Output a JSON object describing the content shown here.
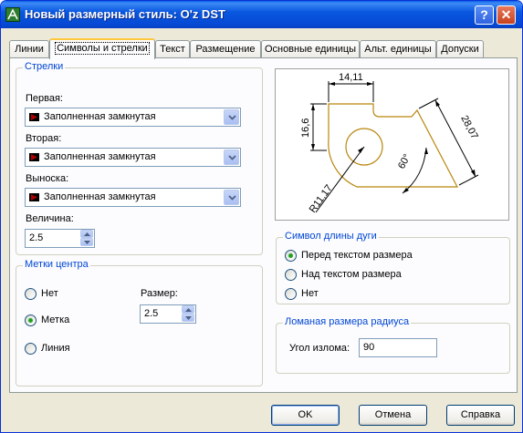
{
  "window": {
    "title": "Новый размерный стиль: O'z DST",
    "help_glyph": "?",
    "close_glyph": "✕"
  },
  "tabs": [
    {
      "label": "Линии"
    },
    {
      "label": "Символы и стрелки"
    },
    {
      "label": "Текст"
    },
    {
      "label": "Размещение"
    },
    {
      "label": "Основные единицы"
    },
    {
      "label": "Альт. единицы"
    },
    {
      "label": "Допуски"
    }
  ],
  "arrows": {
    "group_title": "Стрелки",
    "first_label": "Первая:",
    "first_value": "Заполненная замкнутая",
    "second_label": "Вторая:",
    "second_value": "Заполненная замкнутая",
    "leader_label": "Выноска:",
    "leader_value": "Заполненная замкнутая",
    "size_label": "Величина:",
    "size_value": "2.5"
  },
  "center_marks": {
    "group_title": "Метки центра",
    "options": [
      {
        "label": "Нет",
        "selected": false
      },
      {
        "label": "Метка",
        "selected": true
      },
      {
        "label": "Линия",
        "selected": false
      }
    ],
    "size_label": "Размер:",
    "size_value": "2.5"
  },
  "preview": {
    "dim_top": "14,11",
    "dim_left": "16,6",
    "dim_right": "28,07",
    "dim_angle": "60°",
    "dim_radius": "R11,17"
  },
  "arc_symbol": {
    "group_title": "Символ длины дуги",
    "options": [
      {
        "label": "Перед текстом размера",
        "selected": true
      },
      {
        "label": "Над текстом размера",
        "selected": false
      },
      {
        "label": "Нет",
        "selected": false
      }
    ]
  },
  "jog": {
    "group_title": "Ломаная размера радиуса",
    "angle_label": "Угол излома:",
    "angle_value": "90"
  },
  "buttons": {
    "ok": "OK",
    "cancel": "Отмена",
    "help": "Справка"
  },
  "colors": {
    "titlebar": "#0548d3",
    "group_title": "#0046d5",
    "preview_shape": "#b8860b",
    "radio_dot": "#21a121"
  }
}
